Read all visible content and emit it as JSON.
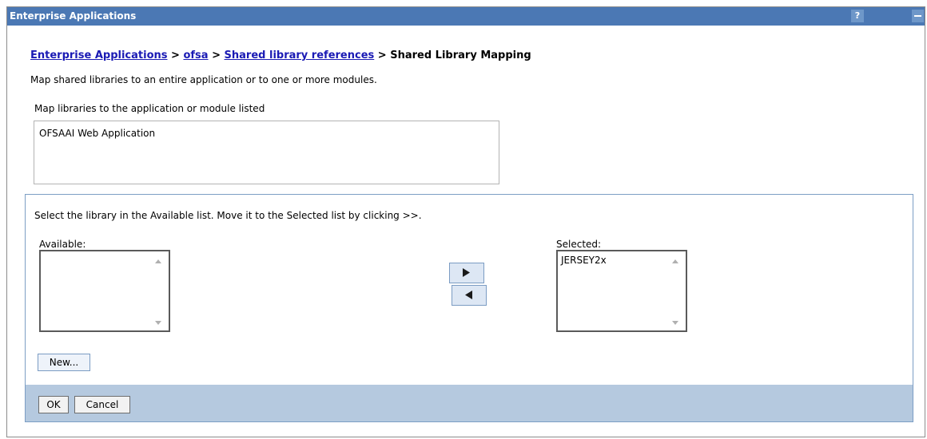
{
  "window": {
    "title": "Enterprise Applications",
    "help_label": "?"
  },
  "breadcrumb": {
    "items": [
      "Enterprise Applications",
      "ofsa",
      "Shared library references"
    ],
    "separator": ">",
    "current": "Shared Library Mapping"
  },
  "description": "Map shared libraries to an entire application or to one or more modules.",
  "module_section": {
    "label": "Map libraries to the application or module listed",
    "modules": [
      "OFSAAI Web Application"
    ]
  },
  "library_selection": {
    "instruction": "Select the library in the Available list. Move it to the Selected list by clicking >>.",
    "available_label": "Available:",
    "available_items": [],
    "selected_label": "Selected:",
    "selected_items": [
      "JERSEY2x"
    ],
    "new_button": "New..."
  },
  "footer": {
    "ok_label": "OK",
    "cancel_label": "Cancel"
  },
  "colors": {
    "titlebar": "#4b78b4",
    "link": "#1a1ab4",
    "footer": "#b5c9df",
    "frame_border": "#7c9ec4"
  }
}
